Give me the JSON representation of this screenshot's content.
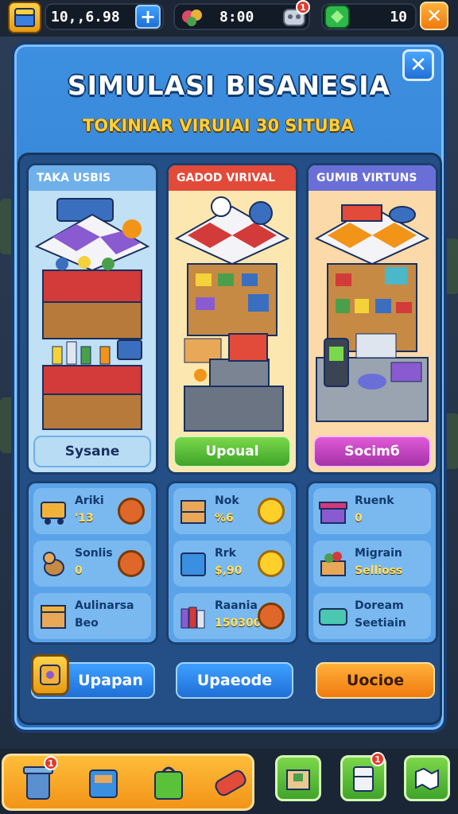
{
  "topbar": {
    "currency": "10,,6.98",
    "time": "8:00",
    "gems": "10",
    "add_label": "+",
    "close_label": "✕",
    "notification_count": "1"
  },
  "panel": {
    "title": "SIMULASI BISANESIA",
    "subtitle": "TOKINIAR VIRUIAI 30 SITUBA",
    "close_label": "✕"
  },
  "shops": [
    {
      "header": "TAKA USBIS",
      "button": "Sysane",
      "header_color": "#6fb0ea",
      "button_color": "#b9dcf5"
    },
    {
      "header": "GADOD VIRIVAL",
      "button": "Upoual",
      "header_color": "#e24a3a",
      "button_color": "#59c234"
    },
    {
      "header": "GUMIB VIRTUNS",
      "button": "Socimб",
      "header_color": "#6a6fd8",
      "button_color": "#c54bc6"
    }
  ],
  "stats": [
    [
      {
        "label": "Ariki",
        "value": "'13",
        "icon": "cart-icon",
        "coin": "copper-coin"
      },
      {
        "label": "Sonlis",
        "value": "0",
        "icon": "dog-icon",
        "coin": "copper-coin"
      },
      {
        "label": "Aulinarsa",
        "value": "Beo",
        "icon": "box-icon",
        "coin": ""
      }
    ],
    [
      {
        "label": "Nok",
        "value": "%6",
        "icon": "crate-icon",
        "coin": "gold-coin"
      },
      {
        "label": "Rrk",
        "value": "$,90",
        "icon": "blue-box-icon",
        "coin": "gold-coin"
      },
      {
        "label": "Raania",
        "value": "150300",
        "icon": "books-icon",
        "coin": "copper-coin"
      }
    ],
    [
      {
        "label": "Ruenk",
        "value": "0",
        "icon": "gift-icon",
        "coin": ""
      },
      {
        "label": "Migrain",
        "value": "Sellioss",
        "icon": "plant-box-icon",
        "coin": ""
      },
      {
        "label": "Doream",
        "value": "Seetiain",
        "icon": "ticket-icon",
        "coin": ""
      }
    ]
  ],
  "actions": [
    "Upapan",
    "Upaeode",
    "Uocioe"
  ],
  "colors": {
    "accent": "#2a6fc4",
    "orange": "#f29418",
    "green": "#59c234"
  }
}
